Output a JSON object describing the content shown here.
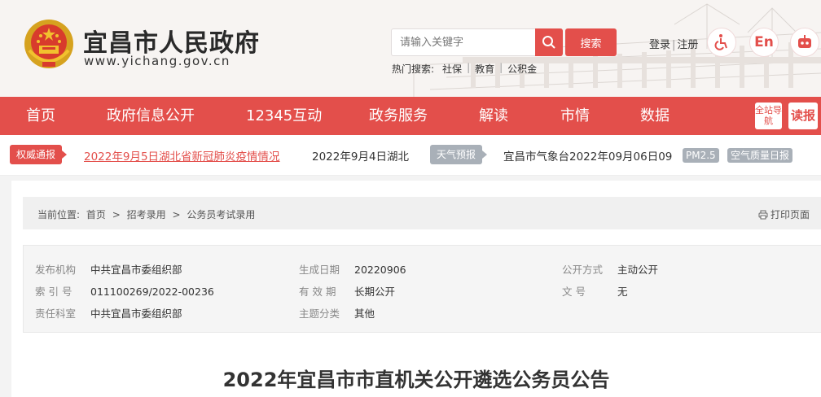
{
  "header": {
    "site_name": "宜昌市人民政府",
    "site_url": "www.yichang.gov.cn",
    "search_placeholder": "请输入关键字",
    "search_button": "搜索",
    "hot_label": "热门搜索:",
    "hot_items": [
      "社保",
      "教育",
      "公积金"
    ],
    "login": "登录",
    "register": "注册",
    "lang_en": "En",
    "accent_color": "#e34f4b"
  },
  "nav": {
    "items": [
      "首页",
      "政府信息公开",
      "12345互动",
      "政务服务",
      "解读",
      "市情",
      "数据"
    ],
    "site_guide": "全站导航",
    "report": "读报"
  },
  "ticker": {
    "tag_authority": "权威通报",
    "news_link": "2022年9月5日湖北省新冠肺炎疫情情况",
    "news_2": "2022年9月4日湖北",
    "tag_weather": "天气预报",
    "weather_text": "宜昌市气象台2022年09月06日09",
    "pm25": "PM2.5",
    "air_quality": "空气质量日报"
  },
  "breadcrumb": {
    "label": "当前位置:",
    "items": [
      "首页",
      "招考录用",
      "公务员考试录用"
    ],
    "separator": ">",
    "print": "打印页面"
  },
  "meta": {
    "publisher_label": "发布机构",
    "publisher": "中共宜昌市委组织部",
    "date_label": "生成日期",
    "date": "20220906",
    "open_label": "公开方式",
    "open": "主动公开",
    "index_label": "索 引 号",
    "index": "011100269/2022-00236",
    "valid_label": "有 效 期",
    "valid": "长期公开",
    "docno_label": "文 号",
    "docno": "无",
    "office_label": "责任科室",
    "office": "中共宜昌市委组织部",
    "topic_label": "主题分类",
    "topic": "其他"
  },
  "document": {
    "title": "2022年宜昌市市直机关公开遴选公务员公告"
  }
}
